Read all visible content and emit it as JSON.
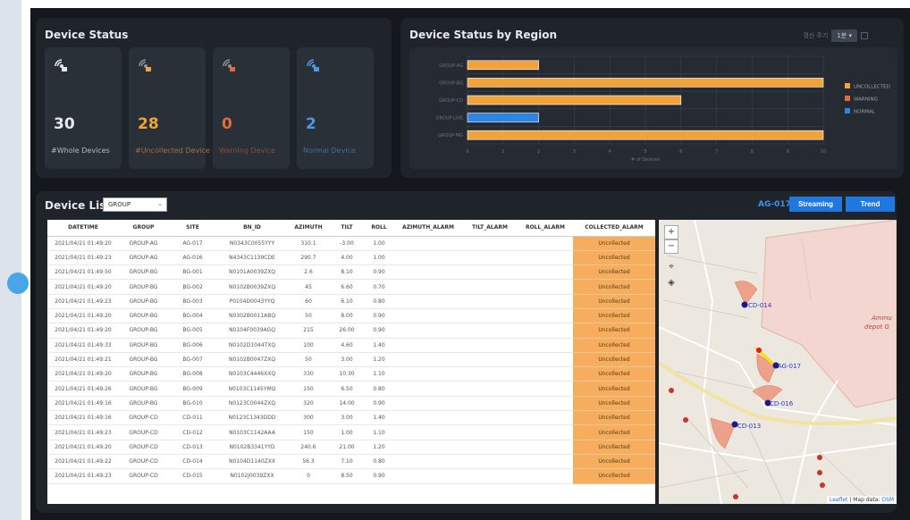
{
  "status": {
    "title": "Device Status",
    "cards": [
      {
        "value": "30",
        "label": "#Whole Devices",
        "color": "#e6e8eb",
        "label_color": "#b5bac2",
        "icon": "radar-icon"
      },
      {
        "value": "28",
        "label": "#Uncollected Device",
        "color": "#f0a33a",
        "label_color": "#a8703a",
        "icon": "radar-uncollected-icon"
      },
      {
        "value": "0",
        "label": "Warning Device",
        "color": "#e56a3a",
        "label_color": "#8a4d38",
        "icon": "radar-warning-icon"
      },
      {
        "value": "2",
        "label": "Normal Device",
        "color": "#4a9ae6",
        "label_color": "#3f6d9a",
        "icon": "radar-normal-icon"
      }
    ]
  },
  "region": {
    "title": "Device Status by Region",
    "refresh_label": "갱신 주기",
    "refresh_value": "1분"
  },
  "chart_data": {
    "type": "bar",
    "orientation": "horizontal",
    "categories": [
      "GROUP-AG",
      "GROUP-BG",
      "GROUP-CD",
      "GROUP-LIVE",
      "GROUP-MG"
    ],
    "series": [
      {
        "name": "UNCOLLECTED",
        "color": "#f0a33a",
        "values": [
          2,
          10,
          6,
          0,
          10
        ]
      },
      {
        "name": "WARNING",
        "color": "#e56a3a",
        "values": [
          0,
          0,
          0,
          0,
          0
        ]
      },
      {
        "name": "NORMAL",
        "color": "#2e84e0",
        "values": [
          0,
          0,
          0,
          2,
          0
        ]
      }
    ],
    "xlabel": "# of Devices",
    "xticks": [
      "0",
      "1",
      "2",
      "3",
      "4",
      "5",
      "6",
      "7",
      "8",
      "9",
      "10"
    ],
    "xlim": [
      0,
      10
    ],
    "grid": true,
    "legend": "right"
  },
  "list": {
    "title": "Device List",
    "group_filter": "GROUP",
    "selected_device": "AG-017",
    "streaming_label": "Streaming",
    "trend_label": "Trend",
    "columns": [
      "DATETIME",
      "GROUP",
      "SITE",
      "BN_ID",
      "AZIMUTH",
      "TILT",
      "ROLL",
      "AZIMUTH_ALARM",
      "TILT_ALARM",
      "ROLL_ALARM",
      "COLLECTED_ALARM"
    ],
    "rows": [
      [
        "2021/04/21 01:49:20",
        "GROUP-AG",
        "AG-017",
        "N0343C0055YYY",
        "310.1",
        "-3.00",
        "1.00",
        "",
        "",
        "",
        "Uncollected"
      ],
      [
        "2021/04/21 01:49:23",
        "GROUP-AG",
        "AG-016",
        "N4343C1139CDE",
        "290.7",
        "4.00",
        "1.00",
        "",
        "",
        "",
        "Uncollected"
      ],
      [
        "2021/04/21 01:49:50",
        "GROUP-BG",
        "BG-001",
        "N0101A0039ZXQ",
        "2.6",
        "8.10",
        "0.90",
        "",
        "",
        "",
        "Uncollected"
      ],
      [
        "2021/04/21 01:49:20",
        "GROUP-BG",
        "BG-002",
        "N0102B0039ZXQ",
        "45",
        "6.60",
        "0.70",
        "",
        "",
        "",
        "Uncollected"
      ],
      [
        "2021/04/21 01:49:23",
        "GROUP-BG",
        "BG-003",
        "P0104D0043YYQ",
        "60",
        "6.10",
        "0.80",
        "",
        "",
        "",
        "Uncollected"
      ],
      [
        "2021/04/21 01:49:20",
        "GROUP-BG",
        "BG-004",
        "N0302B0011ABQ",
        "50",
        "8.00",
        "0.90",
        "",
        "",
        "",
        "Uncollected"
      ],
      [
        "2021/04/21 01:49:20",
        "GROUP-BG",
        "BG-005",
        "N0104F0039AGQ",
        "215",
        "26.00",
        "0.90",
        "",
        "",
        "",
        "Uncollected"
      ],
      [
        "2021/04/21 01:49:33",
        "GROUP-BG",
        "BG-006",
        "N0102D1044TXQ",
        "100",
        "4.60",
        "1.40",
        "",
        "",
        "",
        "Uncollected"
      ],
      [
        "2021/04/21 01:49:21",
        "GROUP-BG",
        "BG-007",
        "N0102B0047ZXQ",
        "50",
        "3.00",
        "1.20",
        "",
        "",
        "",
        "Uncollected"
      ],
      [
        "2021/04/21 01:49:20",
        "GROUP-BG",
        "BG-008",
        "N0103C4446XXQ",
        "330",
        "10.30",
        "1.10",
        "",
        "",
        "",
        "Uncollected"
      ],
      [
        "2021/04/21 01:49:26",
        "GROUP-BG",
        "BG-009",
        "N0103C1145YMQ",
        "150",
        "6.50",
        "0.80",
        "",
        "",
        "",
        "Uncollected"
      ],
      [
        "2021/04/21 01:49:16",
        "GROUP-BG",
        "BG-010",
        "N0123C0044ZXQ",
        "320",
        "14.00",
        "0.90",
        "",
        "",
        "",
        "Uncollected"
      ],
      [
        "2021/04/21 01:49:16",
        "GROUP-CD",
        "CD-011",
        "N0123C1343DDD",
        "300",
        "3.00",
        "1.40",
        "",
        "",
        "",
        "Uncollected"
      ],
      [
        "2021/04/21 01:49:23",
        "GROUP-CD",
        "CD-012",
        "N0103C1142AAA",
        "150",
        "1.00",
        "1.10",
        "",
        "",
        "",
        "Uncollected"
      ],
      [
        "2021/04/21 01:49:20",
        "GROUP-CD",
        "CD-013",
        "N0102B3341YYD",
        "240.6",
        "21.00",
        "1.20",
        "",
        "",
        "",
        "Uncollected"
      ],
      [
        "2021/04/21 01:49:22",
        "GROUP-CD",
        "CD-014",
        "N0104D1140ZXX",
        "56.3",
        "7.10",
        "0.80",
        "",
        "",
        "",
        "Uncollected"
      ],
      [
        "2021/04/21 01:49:23",
        "GROUP-CD",
        "CD-015",
        "N0102J0039ZXX",
        "0",
        "8.50",
        "0.90",
        "",
        "",
        "",
        "Uncollected"
      ]
    ]
  },
  "map": {
    "zoom_in": "+",
    "zoom_out": "−",
    "markers": [
      "CD-014",
      "AG-017",
      "CD-016",
      "CD-013"
    ],
    "area_label_1": "Ammu",
    "area_label_2": "depot G",
    "attribution_leaflet": "Leaflet",
    "attribution_sep": " | Map data: ",
    "attribution_osm": "OSM"
  }
}
